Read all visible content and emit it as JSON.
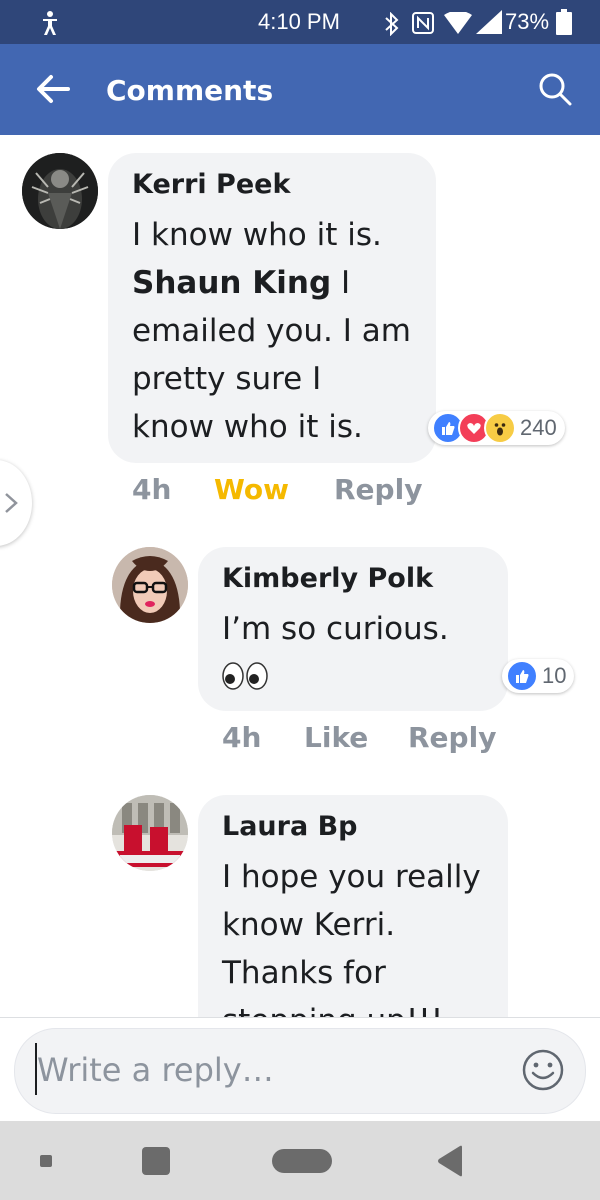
{
  "status_bar": {
    "time": "4:10 PM",
    "battery": "73%",
    "icons": [
      "accessibility-icon",
      "bluetooth-icon",
      "nfc-icon",
      "wifi-icon",
      "signal-icon",
      "battery-icon"
    ]
  },
  "app_bar": {
    "title": "Comments",
    "back_icon": "back-arrow-icon",
    "search_icon": "search-icon"
  },
  "comments": [
    {
      "author": "Kerri Peek",
      "lines": [
        "I know who it is.",
        "Shaun King",
        " I",
        "emailed you. I am",
        "pretty sure I",
        "know who it is."
      ],
      "time": "4h",
      "action": "Wow",
      "reply": "Reply",
      "reactions": {
        "icons": [
          "like-icon",
          "love-icon",
          "wow-icon"
        ],
        "count": "240"
      }
    },
    {
      "author": "Kimberly Polk",
      "lines": [
        "I’m so curious.",
        "👀"
      ],
      "time": "4h",
      "action": "Like",
      "reply": "Reply",
      "reactions": {
        "icons": [
          "like-icon"
        ],
        "count": "10"
      }
    },
    {
      "author": "Laura Bp",
      "lines": [
        "I hope you really",
        "know Kerri.",
        "Thanks for",
        "stepping up!!!"
      ]
    }
  ],
  "composer": {
    "placeholder": "Write a reply…",
    "emoji_icon": "smiley-icon"
  },
  "nav_bar": {
    "icons": [
      "dot-icon",
      "recents-icon",
      "home-icon",
      "back-icon"
    ]
  },
  "colors": {
    "status_bar": "#2f4679",
    "app_bar": "#4267b2",
    "bubble": "#f2f3f5",
    "wow_accent": "#f5b900",
    "meta_gray": "#8d949e"
  }
}
